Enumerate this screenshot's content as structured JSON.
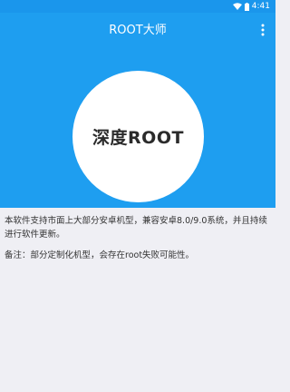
{
  "status_bar": {
    "time": "4:41",
    "wifi_icon": "wifi-icon",
    "battery_icon": "battery-icon"
  },
  "app_bar": {
    "title": "ROOT大师",
    "menu_icon": "more-vert-icon"
  },
  "hero": {
    "button_label": "深度ROOT"
  },
  "content": {
    "description": "本软件支持市面上大部分安卓机型，兼容安卓8.0/9.0系统，并且持续进行软件更新。",
    "note": "备注：部分定制化机型，会存在root失败可能性。"
  },
  "colors": {
    "primary": "#1e9ef0",
    "status_bar": "#1a96ec",
    "background": "#efeff4",
    "text": "#333333"
  }
}
